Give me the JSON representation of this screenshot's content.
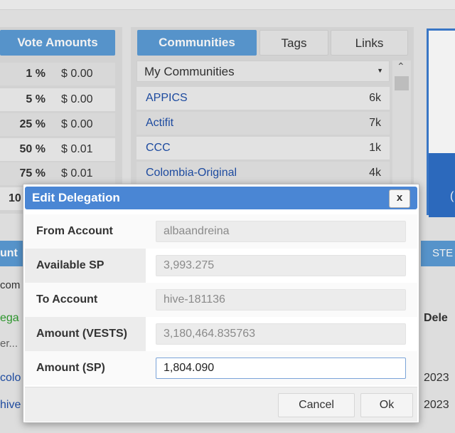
{
  "vote_panel": {
    "header": "Vote Amounts",
    "rows": [
      {
        "pct": "1 %",
        "amount": "$ 0.00"
      },
      {
        "pct": "5 %",
        "amount": "$ 0.00"
      },
      {
        "pct": "25 %",
        "amount": "$ 0.00"
      },
      {
        "pct": "50 %",
        "amount": "$ 0.01"
      },
      {
        "pct": "75 %",
        "amount": "$ 0.01"
      },
      {
        "pct": "10",
        "amount": ""
      }
    ]
  },
  "communities_panel": {
    "tabs": [
      "Communities",
      "Tags",
      "Links"
    ],
    "dropdown_value": "My Communities",
    "items": [
      {
        "name": "APPICS",
        "count": "6k"
      },
      {
        "name": "Actifit",
        "count": "7k"
      },
      {
        "name": "CCC",
        "count": "1k"
      },
      {
        "name": "Colombia-Original",
        "count": "4k"
      }
    ]
  },
  "background": {
    "left_partial_tab": "unt",
    "left_partial_1": "com",
    "left_partial_2": "ega",
    "left_partial_3": "er...",
    "left_partial_4": "colo",
    "left_partial_5": "hive",
    "right_tab": "STE",
    "right_header": "Dele",
    "right_cell_1": "2023",
    "right_cell_2": "2023",
    "right_panel_partial": "("
  },
  "dialog": {
    "title": "Edit Delegation",
    "close_label": "x",
    "fields": [
      {
        "label": "From Account",
        "value": "albaandreina"
      },
      {
        "label": "Available SP",
        "value": "3,993.275"
      },
      {
        "label": "To Account",
        "value": "hive-181136"
      },
      {
        "label": "Amount (VESTS)",
        "value": "3,180,464.835763"
      },
      {
        "label": "Amount (SP)",
        "value": "1,804.090"
      }
    ],
    "cancel_label": "Cancel",
    "ok_label": "Ok"
  },
  "colors": {
    "accent": "#5b9bd5",
    "dialog_title_bg": "#4a86d4",
    "link": "#1f4fa8",
    "green_link": "#2e9e2e"
  }
}
